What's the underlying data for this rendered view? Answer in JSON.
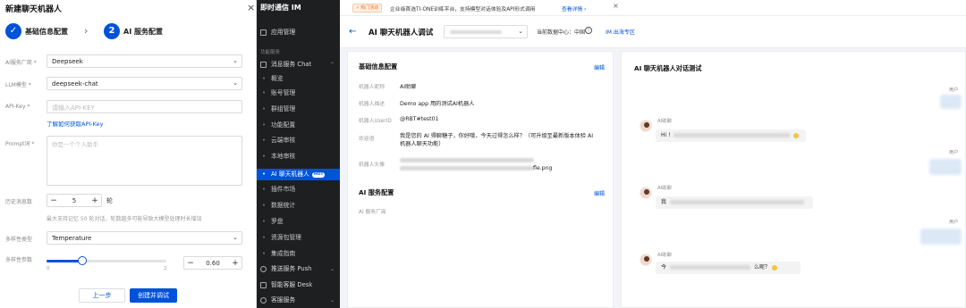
{
  "create_panel": {
    "title": "新建聊天机器人",
    "close": "×",
    "steps": [
      {
        "label": "基础信息配置",
        "mark": "✓"
      },
      {
        "label": "AI 服务配置",
        "mark": "2"
      }
    ],
    "step_arrow": "›",
    "fields": {
      "provider": {
        "label": "AI服务厂商 *",
        "value": "Deepseek"
      },
      "model": {
        "label": "LLM模型 *",
        "value": "deepseek-chat"
      },
      "api_key": {
        "label": "API-Key *",
        "placeholder": "请输入API-KEY",
        "help_link": "了解如何获取API-Key"
      },
      "prompt": {
        "label": "Prompt词 *",
        "placeholder": "你是一个个人助手"
      },
      "history": {
        "label": "历史消息数",
        "minus": "−",
        "value": "5",
        "plus": "+",
        "unit": "轮",
        "help": "最大支持记忆 50 轮对话，轮数越多可能导致大模型处理时长增加"
      },
      "diversity_type": {
        "label": "多样性类型",
        "value": "Temperature"
      },
      "diversity_param": {
        "label": "多样性参数",
        "value": "0.60",
        "min_label": "0",
        "max_label": "2",
        "level": 0.3,
        "minus": "−",
        "plus": "+"
      }
    },
    "buttons": {
      "prev": "上一步",
      "next": "创建并调试"
    }
  },
  "sidebar": {
    "title": "即时通信 IM",
    "items": [
      {
        "label": "应用管理",
        "kind": "top",
        "icon": "app-icon"
      },
      {
        "label": "功能服务",
        "kind": "section"
      },
      {
        "label": "消息服务 Chat",
        "kind": "group",
        "icon": "chat-icon",
        "chevron": "⌃"
      },
      {
        "label": "概览",
        "kind": "sub"
      },
      {
        "label": "账号管理",
        "kind": "sub"
      },
      {
        "label": "群组管理",
        "kind": "sub"
      },
      {
        "label": "功能配置",
        "kind": "sub"
      },
      {
        "label": "云端审核",
        "kind": "sub"
      },
      {
        "label": "本地审核",
        "kind": "sub"
      },
      {
        "label": "AI 聊天机器人",
        "kind": "sub",
        "active": true,
        "badge": "HOT"
      },
      {
        "label": "插件市场",
        "kind": "sub"
      },
      {
        "label": "数据统计",
        "kind": "sub"
      },
      {
        "label": "罗盘",
        "kind": "sub"
      },
      {
        "label": "资源包管理",
        "kind": "sub"
      },
      {
        "label": "集成指南",
        "kind": "sub"
      },
      {
        "label": "推送服务 Push",
        "kind": "group",
        "icon": "push-icon",
        "chevron": "⌄"
      },
      {
        "label": "智能客服 Desk",
        "kind": "group",
        "icon": "desk-icon"
      },
      {
        "label": "客服服务",
        "kind": "group",
        "icon": "service-icon",
        "chevron": "⌄"
      }
    ],
    "accent": "#0052d9"
  },
  "promo": {
    "tag": "⚡ 热门活动",
    "text": "企业级首选TI-ONE训练平台，支持模型对话体验及API形式调用",
    "link": "查看详情 ›",
    "close": "×"
  },
  "subbar": {
    "back": "←",
    "title": "AI 聊天机器人调试",
    "chevron": "⌄",
    "center": "当前数据中心：中国",
    "info": "i",
    "link": "IM 出海专区"
  },
  "basic_info": {
    "title": "基础信息配置",
    "edit": "编辑",
    "rows": [
      {
        "label": "机器人昵称",
        "value": "AI助聊"
      },
      {
        "label": "机器人描述",
        "value": "Demo app 用的测试AI机器人"
      },
      {
        "label": "机器人UserID",
        "value": "@RBT#test01"
      },
      {
        "label": "欢迎语",
        "value": "我是您的 AI 得聊糖子，你好哦，今天过得怎么样？（可升级至最新版本体验 AI 机器人聊天功能）"
      },
      {
        "label": "机器人头像",
        "value": "fle.png"
      }
    ]
  },
  "ai_service": {
    "title": "AI 服务配置",
    "edit": "编辑",
    "rows": [
      {
        "label": "AI 服务厂商",
        "value": ""
      }
    ]
  },
  "chat": {
    "title": "AI 聊天机器人对话测试",
    "user_label": "用户",
    "ai_label": "AI助聊",
    "ai_messages": [
      {
        "prefix": "Hi !"
      },
      {
        "prefix": "我"
      },
      {
        "prefix": "今",
        "suffix": "么呢？"
      }
    ]
  }
}
